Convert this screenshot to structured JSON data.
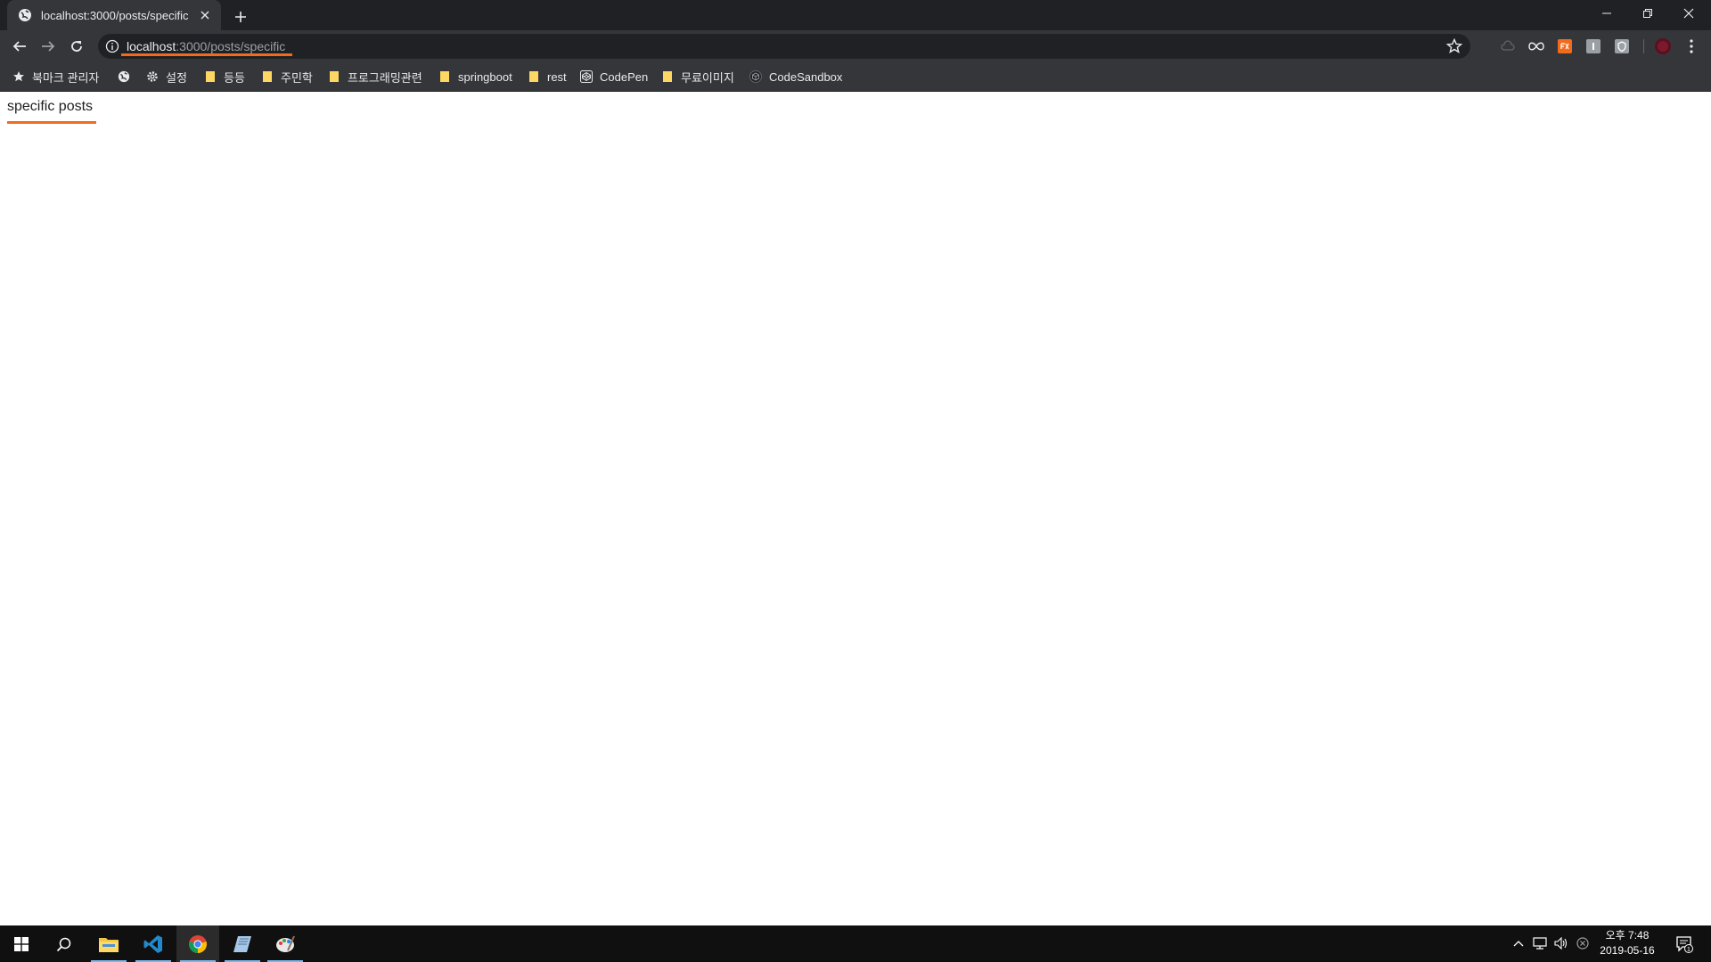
{
  "browser": {
    "tab": {
      "title": "localhost:3000/posts/specific",
      "icon": "globe-icon"
    },
    "omnibox": {
      "url_host": "localhost",
      "url_rest": ":3000/posts/specific"
    },
    "bookmarks": [
      {
        "label": "북마크 관리자",
        "icon": "star-icon"
      },
      {
        "label": "",
        "icon": "globe-icon"
      },
      {
        "label": "설정",
        "icon": "gear-icon"
      },
      {
        "label": "등등",
        "icon": "folder-icon"
      },
      {
        "label": "주민학",
        "icon": "folder-icon"
      },
      {
        "label": "프로그래밍관련",
        "icon": "folder-icon"
      },
      {
        "label": "springboot",
        "icon": "folder-icon"
      },
      {
        "label": "rest",
        "icon": "folder-icon"
      },
      {
        "label": "CodePen",
        "icon": "codepen-icon"
      },
      {
        "label": "무료이미지",
        "icon": "folder-icon"
      },
      {
        "label": "CodeSandbox",
        "icon": "codesandbox-icon"
      }
    ]
  },
  "page": {
    "heading": "specific posts"
  },
  "taskbar": {
    "clock": {
      "time": "오후 7:48",
      "date": "2019-05-16"
    },
    "notification_count": "1"
  },
  "colors": {
    "accent": "#f26b1d",
    "chrome_dark": "#202124",
    "chrome_toolbar": "#35363a"
  }
}
